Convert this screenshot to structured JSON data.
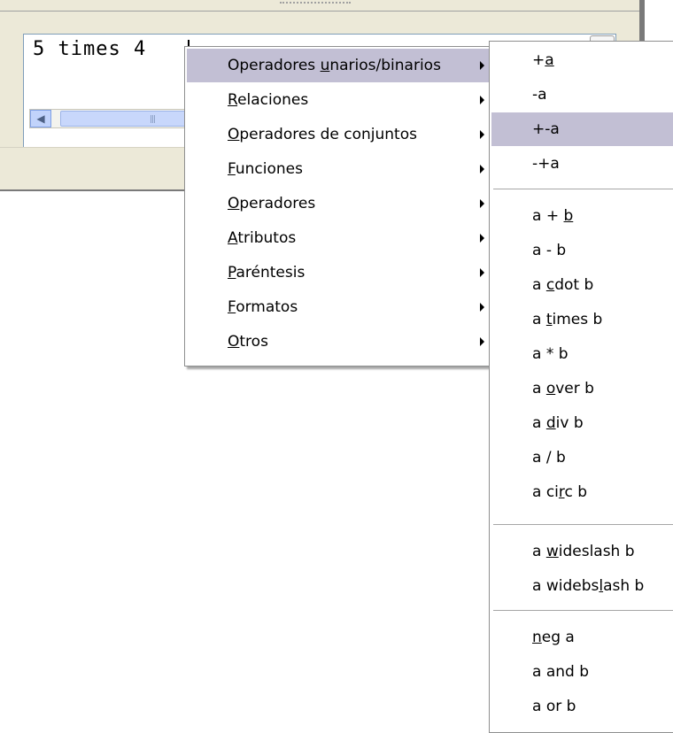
{
  "editor": {
    "text": "5 times 4",
    "scroll_left_glyph": "◀",
    "thumb_grip": "|||"
  },
  "main_menu": {
    "items": [
      {
        "pre": "Operadores ",
        "key": "u",
        "post": "narios/binarios"
      },
      {
        "pre": "",
        "key": "R",
        "post": "elaciones"
      },
      {
        "pre": "",
        "key": "O",
        "post": "peradores de conjuntos"
      },
      {
        "pre": "",
        "key": "F",
        "post": "unciones"
      },
      {
        "pre": "",
        "key": "O",
        "post": "peradores"
      },
      {
        "pre": "",
        "key": "A",
        "post": "tributos"
      },
      {
        "pre": "",
        "key": "P",
        "post": "aréntesis"
      },
      {
        "pre": "",
        "key": "F",
        "post": "ormatos"
      },
      {
        "pre": "",
        "key": "O",
        "post": "tros"
      }
    ]
  },
  "sub_menu": {
    "items": [
      {
        "pre": "+",
        "key": "a",
        "post": ""
      },
      {
        "pre": "-a",
        "key": "",
        "post": ""
      },
      {
        "pre": "+-a",
        "key": "",
        "post": ""
      },
      {
        "pre": "-+a",
        "key": "",
        "post": ""
      },
      {
        "pre": "a + ",
        "key": "b",
        "post": ""
      },
      {
        "pre": "a - b",
        "key": "",
        "post": ""
      },
      {
        "pre": "a ",
        "key": "c",
        "post": "dot b"
      },
      {
        "pre": "a ",
        "key": "t",
        "post": "imes b"
      },
      {
        "pre": "a * b",
        "key": "",
        "post": ""
      },
      {
        "pre": "a ",
        "key": "o",
        "post": "ver b"
      },
      {
        "pre": "a ",
        "key": "d",
        "post": "iv b"
      },
      {
        "pre": "a / b",
        "key": "",
        "post": ""
      },
      {
        "pre": "a ci",
        "key": "r",
        "post": "c b"
      },
      {
        "pre": "a ",
        "key": "w",
        "post": "ideslash b"
      },
      {
        "pre": "a widebs",
        "key": "l",
        "post": "ash b"
      },
      {
        "pre": "",
        "key": "n",
        "post": "eg a"
      },
      {
        "pre": "a and b",
        "key": "",
        "post": ""
      },
      {
        "pre": "a or b",
        "key": "",
        "post": ""
      }
    ]
  },
  "colors": {
    "highlight": "#c2bfd4",
    "window_bg": "#ece9d8"
  }
}
